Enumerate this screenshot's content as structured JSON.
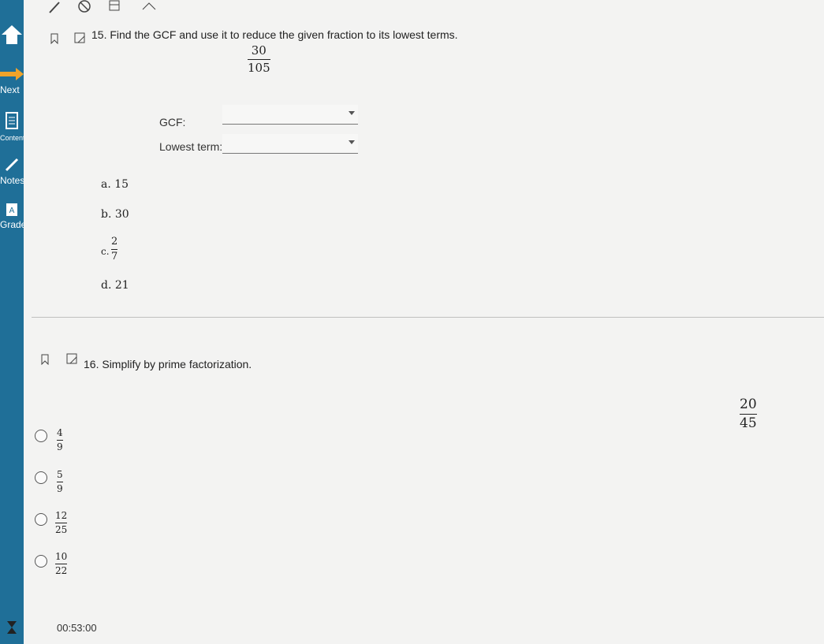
{
  "sidebar": {
    "next_label": "Next",
    "contents_label": "Contents",
    "notes_label": "Notes",
    "grades_label": "Grades"
  },
  "toolbar": {
    "icons": [
      "pencil-icon",
      "no-entry-icon",
      "calculator-icon",
      "ruler-icon"
    ]
  },
  "q15": {
    "number_text": "15. Find the GCF and use it to reduce the given fraction to its lowest terms.",
    "fraction": {
      "num": "30",
      "den": "105"
    },
    "gcf_label": "GCF:",
    "gcf_value": "",
    "lowest_label": "Lowest term:",
    "lowest_value": "",
    "options": [
      {
        "letter": "a.",
        "value": "15"
      },
      {
        "letter": "b.",
        "value": "30"
      },
      {
        "letter": "c.",
        "num": "2",
        "den": "7"
      },
      {
        "letter": "d.",
        "value": "21"
      }
    ]
  },
  "q16": {
    "number_text": "16. Simplify by prime factorization.",
    "fraction": {
      "num": "20",
      "den": "45"
    },
    "options": [
      {
        "num": "4",
        "den": "9"
      },
      {
        "num": "5",
        "den": "9"
      },
      {
        "num": "12",
        "den": "25"
      },
      {
        "num": "10",
        "den": "22"
      }
    ]
  },
  "timer": {
    "value": "00:53:00"
  }
}
